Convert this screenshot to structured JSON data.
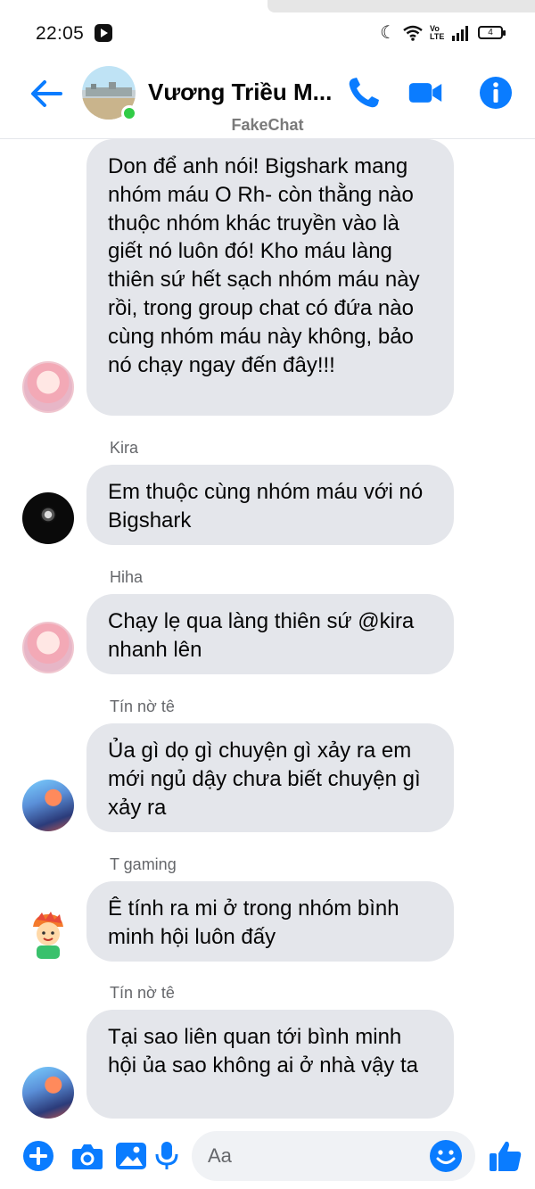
{
  "status_bar": {
    "time": "22:05",
    "network_label": "Vo LTE",
    "battery": "4"
  },
  "header": {
    "contact_name": "Vương Triều M...",
    "watermark": "FakeChat",
    "icons": [
      "back-arrow-icon",
      "phone-icon",
      "video-camera-icon",
      "info-icon"
    ],
    "accent_color": "#0084ff"
  },
  "messages": [
    {
      "sender": "",
      "text": "Don để anh nói! Bigshark mang nhóm máu O Rh- còn thằng nào thuộc nhóm khác truyền vào là giết nó luôn đó! Kho máu làng thiên sứ hết sạch nhóm máu này rồi, trong group chat có đứa nào cùng nhóm máu này không, bảo nó chạy ngay đến đây!!!",
      "avatar": "pink-anime-avatar"
    },
    {
      "sender": "Kira",
      "text": "Em thuộc cùng nhóm máu với nó Bigshark",
      "avatar": "dark-avatar"
    },
    {
      "sender": "Hiha",
      "text": "Chạy lẹ qua làng thiên sứ @kira nhanh lên",
      "avatar": "pink-anime-avatar"
    },
    {
      "sender": "Tín nờ tê",
      "text": "Ủa gì dọ gì chuyện gì xảy ra em mới ngủ dậy chưa biết chuyện gì xảy ra",
      "avatar": "blue-sky-avatar"
    },
    {
      "sender": "T gaming",
      "text": "Ê tính ra mi ở trong nhóm bình minh hội luôn đấy",
      "avatar": "cartoon-kid-avatar"
    },
    {
      "sender": "Tín nờ tê",
      "text": "Tại sao liên quan tới bình minh hội ủa sao không ai ở nhà vậy ta",
      "avatar": "blue-sky-avatar"
    }
  ],
  "composer": {
    "placeholder": "Aa",
    "value": "",
    "icons": [
      "plus-icon",
      "camera-icon",
      "gallery-icon",
      "microphone-icon",
      "emoji-icon",
      "thumbs-up-icon"
    ]
  }
}
